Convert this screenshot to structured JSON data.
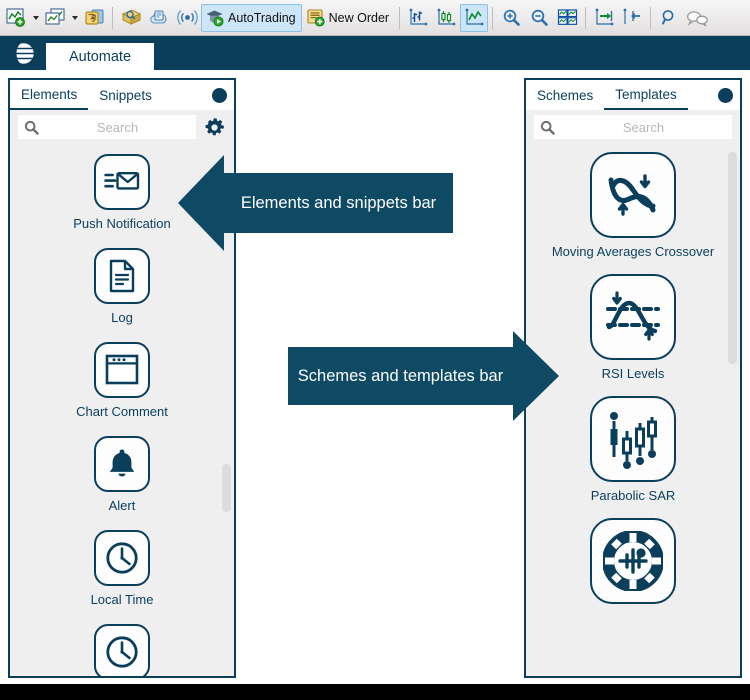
{
  "toolbar": {
    "items": [
      {
        "icon": "new-chart-icon",
        "label": "",
        "type": "icon",
        "caret": true,
        "selected": false
      },
      {
        "icon": "chart-window-icon",
        "label": "",
        "type": "icon",
        "caret": true,
        "selected": false
      },
      {
        "icon": "accounts-icon",
        "label": "",
        "type": "icon",
        "caret": false,
        "selected": false
      },
      {
        "icon": "separator",
        "label": "",
        "type": "sep",
        "caret": false,
        "selected": false
      },
      {
        "icon": "market-watch-icon",
        "label": "",
        "type": "icon",
        "caret": false,
        "selected": false
      },
      {
        "icon": "cloud-storage-icon",
        "label": "",
        "type": "icon",
        "caret": false,
        "selected": false
      },
      {
        "icon": "signals-icon",
        "label": "",
        "type": "icon",
        "caret": false,
        "selected": false
      },
      {
        "icon": "autotrading-icon",
        "label": "AutoTrading",
        "type": "text",
        "caret": false,
        "selected": true
      },
      {
        "icon": "new-order-icon",
        "label": "New Order",
        "type": "text",
        "caret": false,
        "selected": false
      },
      {
        "icon": "separator",
        "label": "",
        "type": "sep",
        "caret": false,
        "selected": false
      },
      {
        "icon": "bar-chart-icon",
        "label": "",
        "type": "icon",
        "caret": false,
        "selected": false
      },
      {
        "icon": "candlestick-chart-icon",
        "label": "",
        "type": "icon",
        "caret": false,
        "selected": false
      },
      {
        "icon": "line-chart-icon",
        "label": "",
        "type": "icon",
        "caret": false,
        "selected": true
      },
      {
        "icon": "separator",
        "label": "",
        "type": "sep",
        "caret": false,
        "selected": false
      },
      {
        "icon": "zoom-in-icon",
        "label": "",
        "type": "icon",
        "caret": false,
        "selected": false
      },
      {
        "icon": "zoom-out-icon",
        "label": "",
        "type": "icon",
        "caret": false,
        "selected": false
      },
      {
        "icon": "tile-windows-icon",
        "label": "",
        "type": "icon",
        "caret": false,
        "selected": false
      },
      {
        "icon": "separator",
        "label": "",
        "type": "sep",
        "caret": false,
        "selected": false
      },
      {
        "icon": "auto-scroll-icon",
        "label": "",
        "type": "icon",
        "caret": false,
        "selected": false
      },
      {
        "icon": "chart-shift-icon",
        "label": "",
        "type": "icon",
        "caret": false,
        "selected": false
      },
      {
        "icon": "separator",
        "label": "",
        "type": "sep",
        "caret": false,
        "selected": false
      },
      {
        "icon": "crosshair-icon",
        "label": "",
        "type": "icon",
        "caret": false,
        "selected": false
      },
      {
        "icon": "comments-icon",
        "label": "",
        "type": "icon",
        "caret": false,
        "selected": false
      }
    ]
  },
  "tabstrip": {
    "logo_icon": "globe-logo-icon",
    "active_tab": "Automate"
  },
  "left_panel": {
    "tabs": [
      {
        "label": "Elements",
        "active": true
      },
      {
        "label": "Snippets",
        "active": false
      }
    ],
    "dot_icon": "panel-menu-dot-icon",
    "search": {
      "placeholder": "Search",
      "value": "",
      "icon": "search-icon"
    },
    "settings_icon": "gear-icon",
    "items": [
      {
        "label": "Push Notification",
        "icon": "push-notification-icon"
      },
      {
        "label": "Log",
        "icon": "log-document-icon"
      },
      {
        "label": "Chart Comment",
        "icon": "chart-comment-icon"
      },
      {
        "label": "Alert",
        "icon": "alert-bell-icon"
      },
      {
        "label": "Local Time",
        "icon": "local-time-clock-icon"
      },
      {
        "label": "",
        "icon": "clock-icon"
      }
    ]
  },
  "right_panel": {
    "tabs": [
      {
        "label": "Schemes",
        "active": false
      },
      {
        "label": "Templates",
        "active": true
      }
    ],
    "dot_icon": "panel-menu-dot-icon",
    "search": {
      "placeholder": "Search",
      "value": "",
      "icon": "search-icon"
    },
    "items": [
      {
        "label": "Moving Averages Crossover",
        "icon": "moving-averages-crossover-icon"
      },
      {
        "label": "RSI Levels",
        "icon": "rsi-levels-icon"
      },
      {
        "label": "Parabolic SAR",
        "icon": "parabolic-sar-icon"
      },
      {
        "label": "",
        "icon": "stochastic-wheel-icon"
      }
    ]
  },
  "callouts": [
    {
      "text": "Elements and snippets bar",
      "direction": "left"
    },
    {
      "text": "Schemes and templates bar",
      "direction": "right"
    }
  ],
  "colors": {
    "accent_dark": "#0b3e5b",
    "callout": "#0e4a64",
    "panel_bg": "#efefef",
    "toolbar_bg": "#ecebeb",
    "selected_tool": "#cde6f7"
  }
}
